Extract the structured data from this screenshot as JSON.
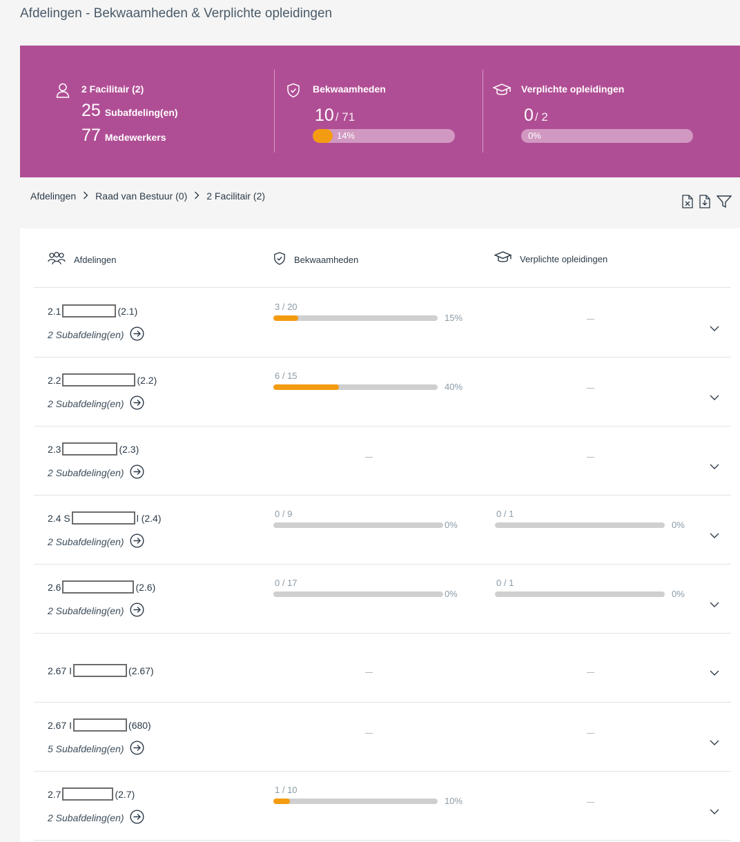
{
  "page_title": "Afdelingen - Bekwaamheden & Verplichte opleidingen",
  "banner": {
    "color": "#b04e95",
    "dept": {
      "name": "2 Facilitair (2)",
      "sub_count": "25",
      "sub_label": "Subafdeling(en)",
      "emp_count": "77",
      "emp_label": "Medewerkers"
    },
    "competences": {
      "title": "Bekwaamheden",
      "done": "10",
      "total": "/ 71",
      "percent": "14%",
      "fraction": 0.14
    },
    "required": {
      "title": "Verplichte opleidingen",
      "done": "0",
      "total": "/ 2",
      "percent": "0%",
      "fraction": 0
    }
  },
  "breadcrumb": [
    "Afdelingen",
    "Raad van Bestuur (0)",
    "2 Facilitair (2)"
  ],
  "toolbar": {
    "icons": [
      "excel-export-icon",
      "download-icon",
      "filter-icon"
    ]
  },
  "table": {
    "headers": {
      "dept": "Afdelingen",
      "competences": "Bekwaamheden",
      "required": "Verplichte opleidingen"
    },
    "rows": [
      {
        "prefix": "2.1",
        "suffix": "(2.1)",
        "sub": "2 Subafdeling(en)",
        "comp": {
          "frac": "3 / 20",
          "pct": "15%",
          "value": 0.15
        },
        "req": null
      },
      {
        "prefix": "2.2",
        "suffix": "(2.2)",
        "sub": "2 Subafdeling(en)",
        "comp": {
          "frac": "6 / 15",
          "pct": "40%",
          "value": 0.4
        },
        "req": null
      },
      {
        "prefix": "2.3",
        "suffix": "(2.3)",
        "sub": "2 Subafdeling(en)",
        "comp": null,
        "req": null
      },
      {
        "prefix": "2.4 S",
        "suffix": "l (2.4)",
        "sub": "2 Subafdeling(en)",
        "comp": {
          "frac": "0 / 9",
          "pct": "0%",
          "value": 0
        },
        "req": {
          "frac": "0 / 1",
          "pct": "0%",
          "value": 0
        }
      },
      {
        "prefix": "2.6",
        "suffix": "(2.6)",
        "sub": "2 Subafdeling(en)",
        "comp": {
          "frac": "0 / 17",
          "pct": "0%",
          "value": 0
        },
        "req": {
          "frac": "0 / 1",
          "pct": "0%",
          "value": 0
        }
      },
      {
        "prefix": "2.67 I",
        "suffix": "(2.67)",
        "sub": "",
        "comp": null,
        "req": null
      },
      {
        "prefix": "2.67 I",
        "suffix": "(680)",
        "sub": "5 Subafdeling(en)",
        "comp": null,
        "req": null
      },
      {
        "prefix": "2.7",
        "suffix": "(2.7)",
        "sub": "2 Subafdeling(en)",
        "comp": {
          "frac": "1 / 10",
          "pct": "10%",
          "value": 0.1
        },
        "req": null
      }
    ]
  }
}
